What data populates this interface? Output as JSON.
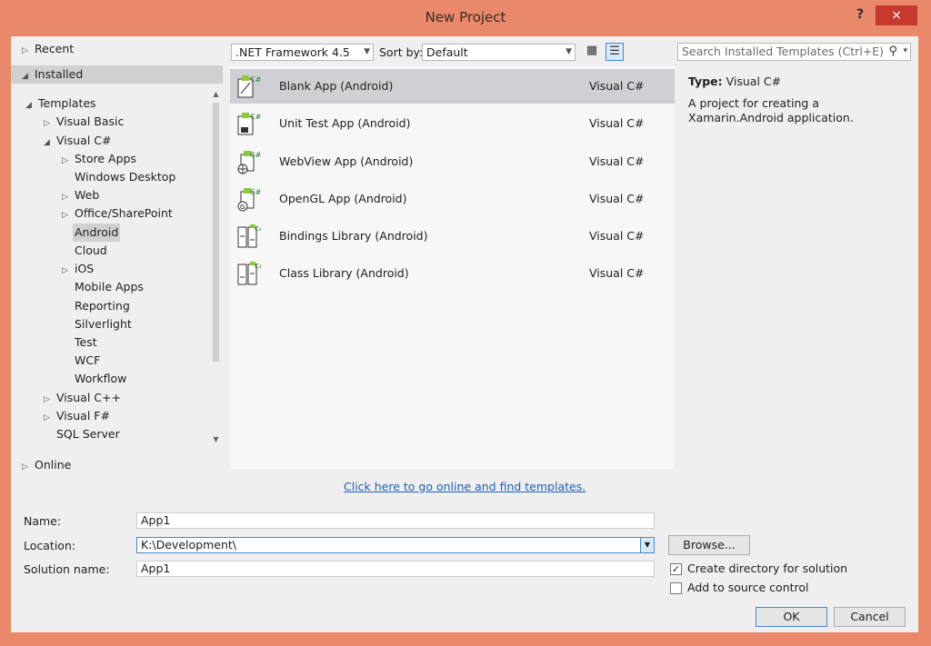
{
  "window": {
    "title": "New Project",
    "help_label": "?",
    "close_label": "×"
  },
  "tree": [
    {
      "label": "Recent",
      "arrow": "▷"
    },
    {
      "label": "Installed",
      "arrow": "◢"
    },
    {
      "label": "Templates",
      "arrow": "◢"
    },
    {
      "label": "Visual Basic",
      "arrow": "▷"
    },
    {
      "label": "Visual C#",
      "arrow": "◢"
    },
    {
      "label": "Store Apps",
      "arrow": "▷"
    },
    {
      "label": "Windows Desktop",
      "arrow": ""
    },
    {
      "label": "Web",
      "arrow": "▷"
    },
    {
      "label": "Office/SharePoint",
      "arrow": "▷"
    },
    {
      "label": "Android",
      "arrow": ""
    },
    {
      "label": "Cloud",
      "arrow": ""
    },
    {
      "label": "iOS",
      "arrow": "▷"
    },
    {
      "label": "Mobile Apps",
      "arrow": ""
    },
    {
      "label": "Reporting",
      "arrow": ""
    },
    {
      "label": "Silverlight",
      "arrow": ""
    },
    {
      "label": "Test",
      "arrow": ""
    },
    {
      "label": "WCF",
      "arrow": ""
    },
    {
      "label": "Workflow",
      "arrow": ""
    },
    {
      "label": "Visual C++",
      "arrow": "▷"
    },
    {
      "label": "Visual F#",
      "arrow": "▷"
    },
    {
      "label": "SQL Server",
      "arrow": ""
    },
    {
      "label": "Online",
      "arrow": "▷"
    }
  ],
  "toolbar": {
    "framework": ".NET Framework 4.5",
    "sort_label": "Sort by:",
    "sort_value": "Default",
    "search_placeholder": "Search Installed Templates (Ctrl+E)"
  },
  "templates": [
    {
      "name": "Blank App (Android)",
      "lang": "Visual C#"
    },
    {
      "name": "Unit Test App (Android)",
      "lang": "Visual C#"
    },
    {
      "name": "WebView App (Android)",
      "lang": "Visual C#"
    },
    {
      "name": "OpenGL App (Android)",
      "lang": "Visual C#"
    },
    {
      "name": "Bindings Library (Android)",
      "lang": "Visual C#"
    },
    {
      "name": "Class Library (Android)",
      "lang": "Visual C#"
    }
  ],
  "details": {
    "type_label": "Type:",
    "type_value": "Visual C#",
    "description": "A project for creating a Xamarin.Android application."
  },
  "online_link": "Click here to go online and find templates.",
  "form": {
    "name_label": "Name:",
    "name_value": "App1",
    "location_label": "Location:",
    "location_value": "K:\\Development\\",
    "solution_label": "Solution name:",
    "solution_value": "App1",
    "browse_label": "Browse...",
    "create_dir_label": "Create directory for solution",
    "create_dir_checked": true,
    "source_control_label": "Add to source control",
    "ok_label": "OK",
    "cancel_label": "Cancel"
  }
}
